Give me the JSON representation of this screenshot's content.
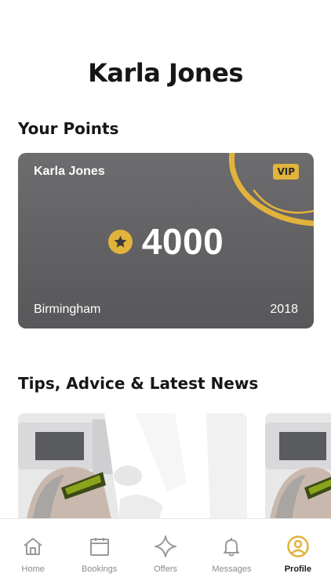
{
  "profile": {
    "name": "Karla Jones"
  },
  "points_section": {
    "title": "Your Points"
  },
  "card": {
    "name": "Karla Jones",
    "badge": "VIP",
    "points": "4000",
    "city": "Birmingham",
    "year": "2018",
    "points_icon": "star-icon",
    "accent": "#e2b33c"
  },
  "news_section": {
    "title": "Tips, Advice & Latest News"
  },
  "tabs": [
    {
      "label": "Home",
      "icon": "home-icon"
    },
    {
      "label": "Bookings",
      "icon": "calendar-icon"
    },
    {
      "label": "Offers",
      "icon": "sparkle-icon"
    },
    {
      "label": "Messages",
      "icon": "bell-icon"
    },
    {
      "label": "Profile",
      "icon": "profile-icon",
      "active": true
    }
  ]
}
